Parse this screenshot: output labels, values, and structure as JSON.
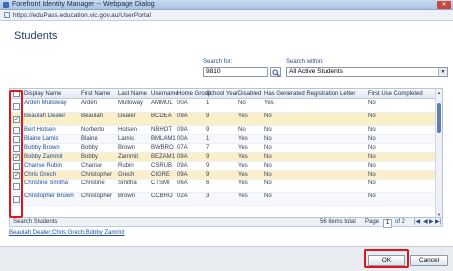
{
  "window": {
    "title": "Forefront Identity Manager -- Webpage Dialog",
    "close_glyph": "✕"
  },
  "address": {
    "url": "https://eduPass.education.vic.gov.au/UserPortal"
  },
  "page_title": "Students",
  "search": {
    "for_label": "Search for:",
    "for_value": "9810",
    "within_label": "Search within:",
    "within_value": "All Active Students"
  },
  "grid": {
    "columns": [
      "Display Name",
      "First Name",
      "Last Name",
      "Username",
      "Home Group",
      "School Year",
      "Disabled",
      "Has Generated Registration Letter",
      "First Use Completed"
    ],
    "rows": [
      {
        "checked": false,
        "cells": [
          "Arden Mulloway",
          "Arden",
          "Mulloway",
          "AMMUL",
          "00A",
          "1",
          "No",
          "Yes",
          "No"
        ]
      },
      {
        "checked": true,
        "cells": [
          "Beaulah Dealer",
          "Beaulah",
          "Dealer",
          "BCDEA",
          "09A",
          "9",
          "Yes",
          "No",
          "No"
        ]
      },
      {
        "checked": false,
        "cells": [
          "Bert Hotsen",
          "Norberto",
          "Hotsen",
          "NBHOT",
          "09A",
          "9",
          "No",
          "No",
          "No"
        ]
      },
      {
        "checked": false,
        "cells": [
          "Blaine Lamis",
          "Blaine",
          "Lamis",
          "BMLAM1",
          "00A",
          "1",
          "Yes",
          "No",
          "No"
        ]
      },
      {
        "checked": false,
        "cells": [
          "Bobby Brown",
          "Bobby",
          "Brown",
          "BWBRO",
          "07A",
          "7",
          "Yes",
          "No",
          "No"
        ]
      },
      {
        "checked": true,
        "cells": [
          "Bobby Zammit",
          "Bobby",
          "Zammit",
          "BEZAM1",
          "09A",
          "9",
          "Yes",
          "No",
          "No"
        ]
      },
      {
        "checked": false,
        "cells": [
          "Charise Rubin",
          "Charise",
          "Rubin",
          "CSRUB",
          "09A",
          "9",
          "Yes",
          "No",
          "No"
        ]
      },
      {
        "checked": true,
        "cells": [
          "Chris Grech",
          "Christopher",
          "Grech",
          "CIGRE",
          "09A",
          "9",
          "Yes",
          "No",
          "No"
        ]
      },
      {
        "checked": false,
        "cells": [
          "Christine Smitha",
          "Christine",
          "Smitha",
          "CTSMI",
          "06A",
          "6",
          "Yes",
          "No",
          "No"
        ]
      },
      {
        "checked": false,
        "cells": [
          "Christopher Brown",
          "Christopher",
          "Brown",
          "CCBRO",
          "02A",
          "3",
          "Yes",
          "No",
          "No"
        ]
      }
    ]
  },
  "footer": {
    "search_students_label": "Search Students",
    "items_total": "56 items total",
    "page_label": "Page",
    "page_current": "1",
    "page_of": "of 2",
    "pager_first": "|◀",
    "pager_prev": "◀",
    "pager_next": "▶",
    "pager_last": "▶|",
    "selected": "Beaulah Dealer;Chris Grech;Bobby Zammit"
  },
  "buttons": {
    "ok": "OK",
    "cancel": "Cancel"
  },
  "colors": {
    "highlight": "#e0151a",
    "selected_row": "#fbefc9",
    "link": "#1c4fa3"
  },
  "icons": {
    "search": "magnifier-icon",
    "dropdown": "chevron-down-icon",
    "lock": "lock-icon"
  }
}
